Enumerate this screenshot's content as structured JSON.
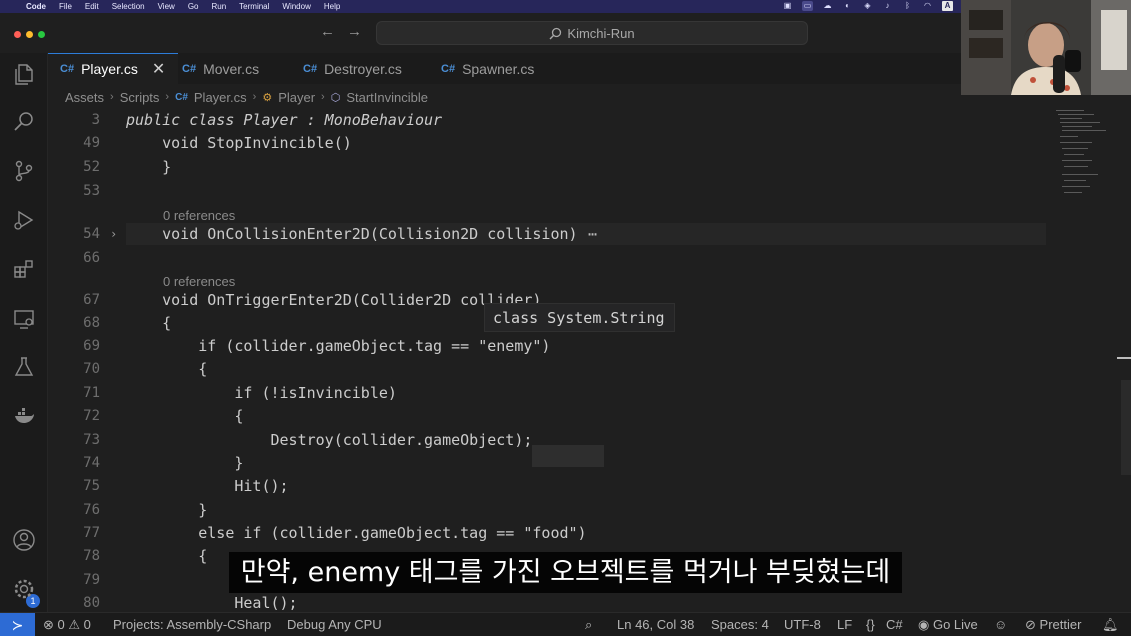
{
  "menubar": {
    "items": [
      "Code",
      "File",
      "Edit",
      "Selection",
      "View",
      "Go",
      "Run",
      "Terminal",
      "Window",
      "Help"
    ],
    "input_indicator": "A"
  },
  "titlebar": {
    "search_text": "Kimchi-Run"
  },
  "tabs": [
    {
      "icon": "C#",
      "label": "Player.cs",
      "active": true
    },
    {
      "icon": "C#",
      "label": "Mover.cs",
      "active": false
    },
    {
      "icon": "C#",
      "label": "Destroyer.cs",
      "active": false
    },
    {
      "icon": "C#",
      "label": "Spawner.cs",
      "active": false
    }
  ],
  "breadcrumb": [
    "Assets",
    "Scripts",
    "Player.cs",
    "Player",
    "StartInvincible"
  ],
  "editor": {
    "lines": [
      {
        "n": "3",
        "code": "public class Player : MonoBehaviour"
      },
      {
        "n": "49",
        "code": "    void StopInvincible()"
      },
      {
        "n": "52",
        "code": "    }"
      },
      {
        "n": "53",
        "code": ""
      },
      {
        "lens": "0 references"
      },
      {
        "n": "54",
        "code": "    void OnCollisionEnter2D(Collision2D collision)",
        "folded": true,
        "fold_marker": "⋯"
      },
      {
        "n": "66",
        "code": ""
      },
      {
        "lens": "0 references"
      },
      {
        "n": "67",
        "code": "    void OnTriggerEnter2D(Collider2D collider)"
      },
      {
        "n": "68",
        "code": "    {"
      },
      {
        "n": "69",
        "code": "        if (collider.gameObject.tag == \"enemy\")"
      },
      {
        "n": "70",
        "code": "        {"
      },
      {
        "n": "71",
        "code": "            if (!isInvincible)"
      },
      {
        "n": "72",
        "code": "            {"
      },
      {
        "n": "73",
        "code": "                Destroy(collider.gameObject);"
      },
      {
        "n": "74",
        "code": "            }"
      },
      {
        "n": "75",
        "code": "            Hit();"
      },
      {
        "n": "76",
        "code": "        }"
      },
      {
        "n": "77",
        "code": "        else if (collider.gameObject.tag == \"food\")"
      },
      {
        "n": "78",
        "code": "        {"
      },
      {
        "n": "79",
        "code": ""
      },
      {
        "n": "80",
        "code": "            Heal();"
      }
    ],
    "tooltip": "class System.String"
  },
  "subtitle": "만약, enemy 태그를 가진 오브젝트를 먹거나 부딪혔는데",
  "activity_badge": "1",
  "statusbar": {
    "errors": "0",
    "warnings": "0",
    "project": "Projects: Assembly-CSharp",
    "config": "Debug Any CPU",
    "position": "Ln 46, Col 38",
    "spaces": "Spaces: 4",
    "encoding": "UTF-8",
    "eol": "LF",
    "language": "C#",
    "golive": "Go Live",
    "prettier": "Prettier"
  },
  "colors": {
    "accent": "#2d6bd4",
    "menubar": "#27265a",
    "editor_bg": "#1f1f1f"
  }
}
